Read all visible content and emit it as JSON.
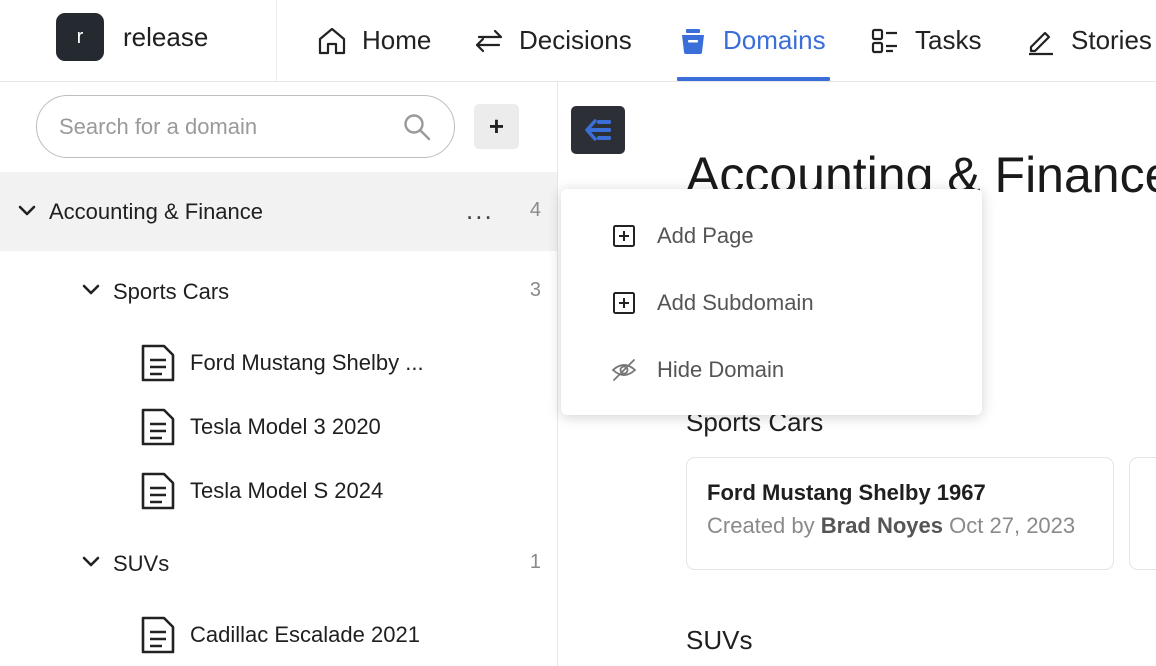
{
  "app": {
    "avatar_letter": "r",
    "name": "release"
  },
  "nav": {
    "items": [
      {
        "label": "Home",
        "icon": "home-icon"
      },
      {
        "label": "Decisions",
        "icon": "arrows-exchange-icon"
      },
      {
        "label": "Domains",
        "icon": "basket-icon",
        "active": true
      },
      {
        "label": "Tasks",
        "icon": "list-icon"
      },
      {
        "label": "Stories",
        "icon": "pencil-icon"
      }
    ],
    "accent_color": "#3a6ed8"
  },
  "sidebar": {
    "search_placeholder": "Search for a domain",
    "add_label": "+",
    "more_label": "...",
    "tree": {
      "root": {
        "label": "Accounting & Finance",
        "count": "4"
      },
      "groups": [
        {
          "label": "Sports Cars",
          "count": "3",
          "pages": [
            "Ford Mustang Shelby ...",
            "Tesla Model 3 2020",
            "Tesla Model S 2024"
          ]
        },
        {
          "label": "SUVs",
          "count": "1",
          "pages": [
            "Cadillac Escalade 2021"
          ]
        }
      ]
    }
  },
  "main": {
    "title": "Accounting & Finance",
    "sections": [
      {
        "title": "Sports Cars",
        "cards": [
          {
            "title": "Ford Mustang Shelby 1967",
            "created_by_label": "Created by",
            "author": "Brad Noyes",
            "date": "Oct 27, 2023"
          }
        ]
      },
      {
        "title": "SUVs"
      }
    ]
  },
  "context_menu": {
    "items": [
      {
        "label": "Add Page",
        "icon": "plus-square-icon"
      },
      {
        "label": "Add Subdomain",
        "icon": "plus-square-icon"
      },
      {
        "label": "Hide Domain",
        "icon": "eye-off-icon"
      }
    ]
  }
}
